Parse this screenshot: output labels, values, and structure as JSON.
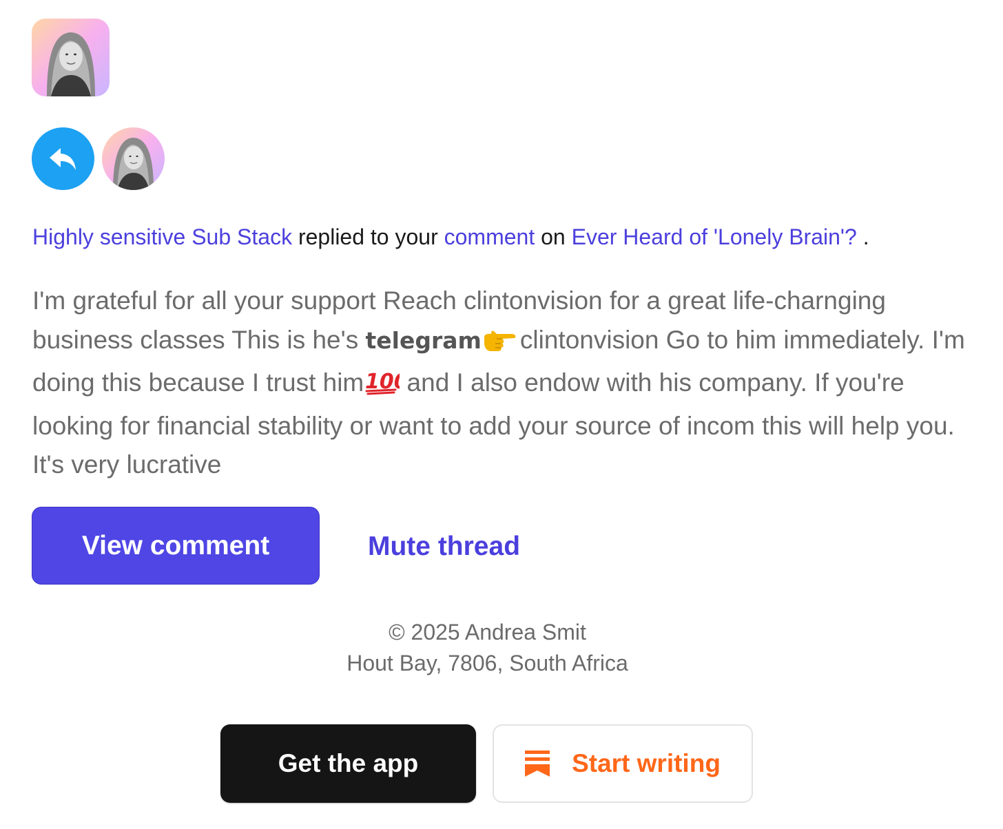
{
  "colors": {
    "link": "#4b3fdd",
    "primary_button": "#4f46e5",
    "reply_badge": "#1da1f2",
    "body_text": "#6b6b6b",
    "app_button": "#151515",
    "substack_orange": "#ff6719"
  },
  "header": {
    "publication_logo_icon": "portrait-photo",
    "reply_icon": "reply-arrow-icon",
    "avatar_icon": "portrait-photo"
  },
  "notification": {
    "actor": "Highly sensitive Sub Stack",
    "action": " replied to your ",
    "target": "comment",
    "preposition": " on ",
    "post_title": "Ever Heard of 'Lonely Brain'?",
    "end": " ."
  },
  "comment": {
    "part1": "I'm grateful for all your support Reach clintonvision for a great life-charnging business classes This is he's ",
    "bold": "telegram",
    "emoji1": "backhand-index-pointing-right-emoji",
    "part2": "clintonvision Go to him immediately. I'm doing this because I trust him",
    "emoji2": "hundred-points-emoji",
    "part3": " and I also endow with his company. If you're looking for financial stability or want to add your source of incom this will help you. It's very lucrative"
  },
  "actions": {
    "view_comment": "View comment",
    "mute_thread": "Mute thread"
  },
  "footer": {
    "copyright": "© 2025 Andrea Smit",
    "address": "Hout Bay, 7806, South Africa",
    "get_app": "Get the app",
    "start_writing": "Start writing",
    "start_writing_icon": "substack-logo-icon"
  }
}
